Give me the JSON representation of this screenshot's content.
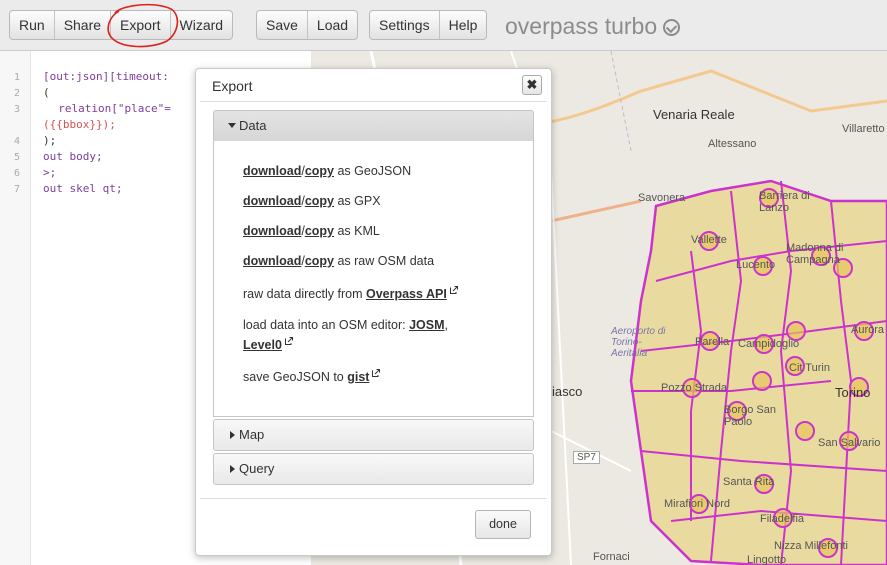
{
  "toolbar": {
    "groups": [
      [
        "Run",
        "Share",
        "Export",
        "Wizard"
      ],
      [
        "Save",
        "Load"
      ],
      [
        "Settings",
        "Help"
      ]
    ],
    "brand": "overpass turbo"
  },
  "editor": {
    "line_numbers": [
      "1",
      "2",
      "3",
      "4",
      "5",
      "6",
      "7"
    ],
    "lines": {
      "l1": "[out:json][timeout:",
      "l2": "(",
      "l3a": "  relation[\"place\"=",
      "l3b": "({{bbox}});",
      "l4": ");",
      "l5": "out body;",
      "l6": ">;",
      "l7": "out skel qt;"
    }
  },
  "map": {
    "labels": {
      "venaria": "Venaria Reale",
      "altessano": "Altessano",
      "villaretto": "Villaretto",
      "savonera": "Savonera",
      "barriera": "Barriera di Lanzo",
      "vallette": "Vallette",
      "madonna": "Madonna di Campagna",
      "lucento": "Lucento",
      "aeroporto": "Aeroporto di Torino-Aeritalia",
      "parella": "Parella",
      "campidoglio": "Campidoglio",
      "aurora": "Aurora",
      "citturin": "Cit Turin",
      "pozzo": "Pozzo Strada",
      "torino": "Torino",
      "grugliasco": "iasco",
      "borgo": "Borgo San Paolo",
      "sansalvario": "San Salvario",
      "sp7": "SP7",
      "santarita": "Santa Rita",
      "mirafiori": "Mirafiori Nord",
      "filadelfia": "Filadelfia",
      "nizza": "Nizza Millefonti",
      "lingotto": "Lingotto",
      "fornaci": "Fornaci"
    }
  },
  "dialog": {
    "title": "Export",
    "close": "✖",
    "sections": {
      "data": "Data",
      "map": "Map",
      "query": "Query"
    },
    "rows": [
      {
        "download": "download",
        "sep": "/",
        "copy": "copy",
        "rest": " as GeoJSON"
      },
      {
        "download": "download",
        "sep": "/",
        "copy": "copy",
        "rest": " as GPX"
      },
      {
        "download": "download",
        "sep": "/",
        "copy": "copy",
        "rest": " as KML"
      },
      {
        "download": "download",
        "sep": "/",
        "copy": "copy",
        "rest": " as raw OSM data"
      }
    ],
    "raw_text": "raw data directly from ",
    "raw_link": "Overpass API",
    "editor_text": "load data into an OSM editor: ",
    "josm": "JOSM",
    "comma": ",",
    "level0": "Level0",
    "gist_text": "save GeoJSON to ",
    "gist": "gist",
    "done": "done"
  },
  "colors": {
    "boundary": "#cc33cc",
    "fill": "#e8d58a",
    "annotation": "#e0201b"
  }
}
